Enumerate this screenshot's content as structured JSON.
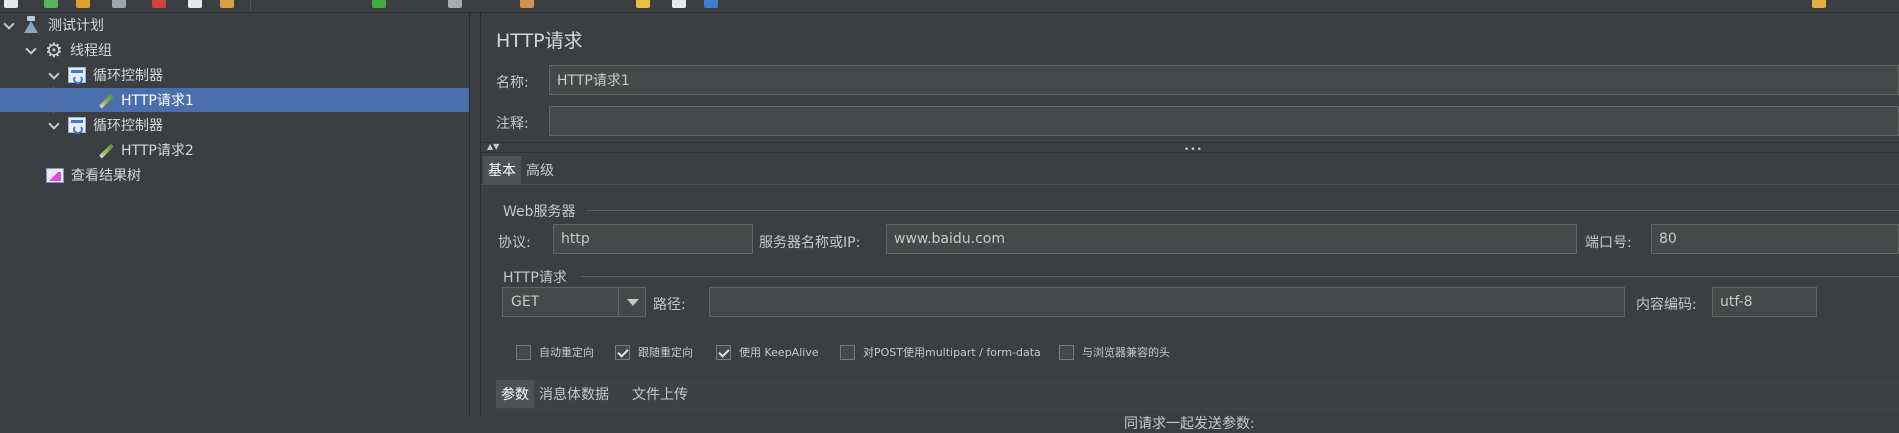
{
  "tree": {
    "items": [
      {
        "label": "测试计划",
        "icon": "test-plan-icon"
      },
      {
        "label": "线程组",
        "icon": "gear-icon"
      },
      {
        "label": "循环控制器",
        "icon": "loop-controller-icon"
      },
      {
        "label": "HTTP请求1",
        "icon": "sampler-pen-icon",
        "selected": true
      },
      {
        "label": "循环控制器",
        "icon": "loop-controller-icon"
      },
      {
        "label": "HTTP请求2",
        "icon": "sampler-pen-icon"
      },
      {
        "label": "查看结果树",
        "icon": "results-tree-icon"
      }
    ]
  },
  "panel": {
    "title": "HTTP请求",
    "name_label": "名称:",
    "name_value": "HTTP请求1",
    "comment_label": "注释:",
    "comment_value": "",
    "collapse_arrows": "▲▼",
    "grip": "•••",
    "tabs": [
      {
        "label": "基本",
        "active": true
      },
      {
        "label": "高级",
        "active": false
      }
    ],
    "web_server": {
      "group_title": "Web服务器",
      "protocol_label": "协议:",
      "protocol_value": "http",
      "server_label": "服务器名称或IP:",
      "server_value": "www.baidu.com",
      "port_label": "端口号:",
      "port_value": "80"
    },
    "http_request": {
      "group_title": "HTTP请求",
      "method": "GET",
      "path_label": "路径:",
      "path_value": "",
      "encoding_label": "内容编码:",
      "encoding_value": "utf-8"
    },
    "options": [
      {
        "label": "自动重定向",
        "checked": false
      },
      {
        "label": "跟随重定向",
        "checked": true
      },
      {
        "label": "使用 KeepAlive",
        "checked": true
      },
      {
        "label": "对POST使用multipart / form-data",
        "checked": false
      },
      {
        "label": "与浏览器兼容的头",
        "checked": false
      }
    ],
    "subtabs": [
      {
        "label": "参数",
        "active": true
      },
      {
        "label": "消息体数据",
        "active": false
      },
      {
        "label": "文件上传",
        "active": false
      }
    ],
    "params_caption": "同请求一起发送参数:"
  },
  "colors": {
    "background": "#3c3f41",
    "selection": "#4b6eaf",
    "field_bg": "#45494a"
  }
}
